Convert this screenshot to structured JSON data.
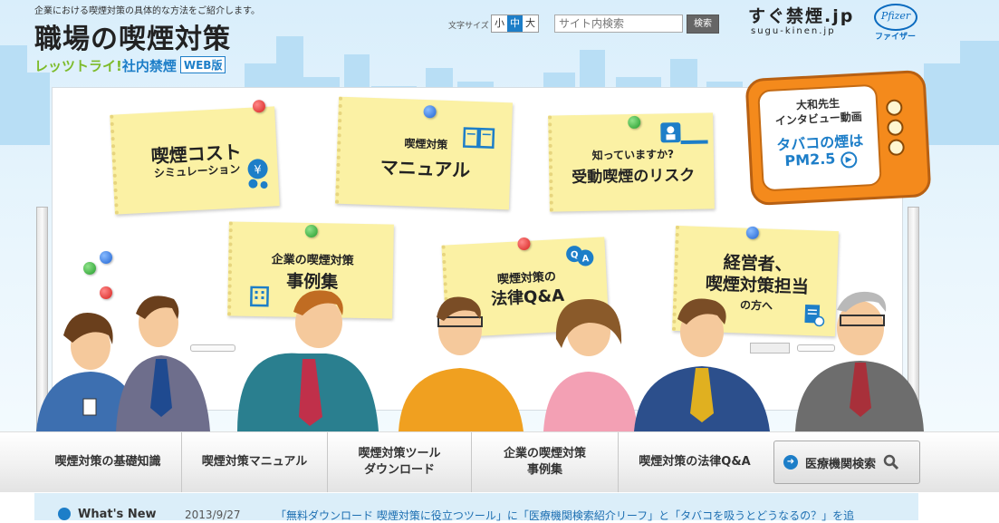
{
  "header": {
    "tagline": "企業における喫煙対策の具体的な方法をご紹介します。",
    "title": "職場の喫煙対策",
    "subtitle_green": "レッツトライ!",
    "subtitle_blue": "社内禁煙",
    "web_badge": "WEB版"
  },
  "font_size": {
    "label": "文字サイズ",
    "options": [
      "小",
      "中",
      "大"
    ],
    "selected": "中"
  },
  "search": {
    "placeholder": "サイト内検索",
    "button_label": "検索"
  },
  "site_logo": {
    "text": "すぐ禁煙.jp",
    "sub": "sugu-kinen.jp"
  },
  "sponsor": {
    "logo_text": "Pfizer",
    "name": "ファイザー"
  },
  "notes": {
    "cost": {
      "line1": "喫煙コスト",
      "line2": "シミュレーション"
    },
    "manual": {
      "line1": "喫煙対策",
      "line2": "マニュアル"
    },
    "risk": {
      "line1": "知っていますか?",
      "line2": "受動喫煙のリスク"
    },
    "cases": {
      "line1": "企業の喫煙対策",
      "line2": "事例集"
    },
    "law": {
      "line1": "喫煙対策の",
      "line2": "法律Q&A"
    },
    "managers": {
      "line1": "経営者、",
      "line2": "喫煙対策担当",
      "line3": "の方へ"
    }
  },
  "tv": {
    "line1": "大和先生",
    "line2": "インタビュー動画",
    "line3": "タバコの煙は",
    "line4": "PM2.5"
  },
  "nav": {
    "items": [
      "喫煙対策の基礎知識",
      "喫煙対策マニュアル",
      "喫煙対策ツール\nダウンロード",
      "企業の喫煙対策\n事例集",
      "喫煙対策の法律Q&A"
    ],
    "medical_search": "医療機関検索"
  },
  "news": {
    "label": "What's New",
    "date": "2013/9/27",
    "text": "「無料ダウンロード 喫煙対策に役立つツール」に「医療機関検索紹介リーフ」と「タバコを吸うとどうなるの？」を追"
  },
  "colors": {
    "accent_blue": "#1d7ec8",
    "brand_green": "#7dbb2a",
    "note_yellow": "#fbf1a4",
    "tv_orange": "#f48a1c"
  }
}
